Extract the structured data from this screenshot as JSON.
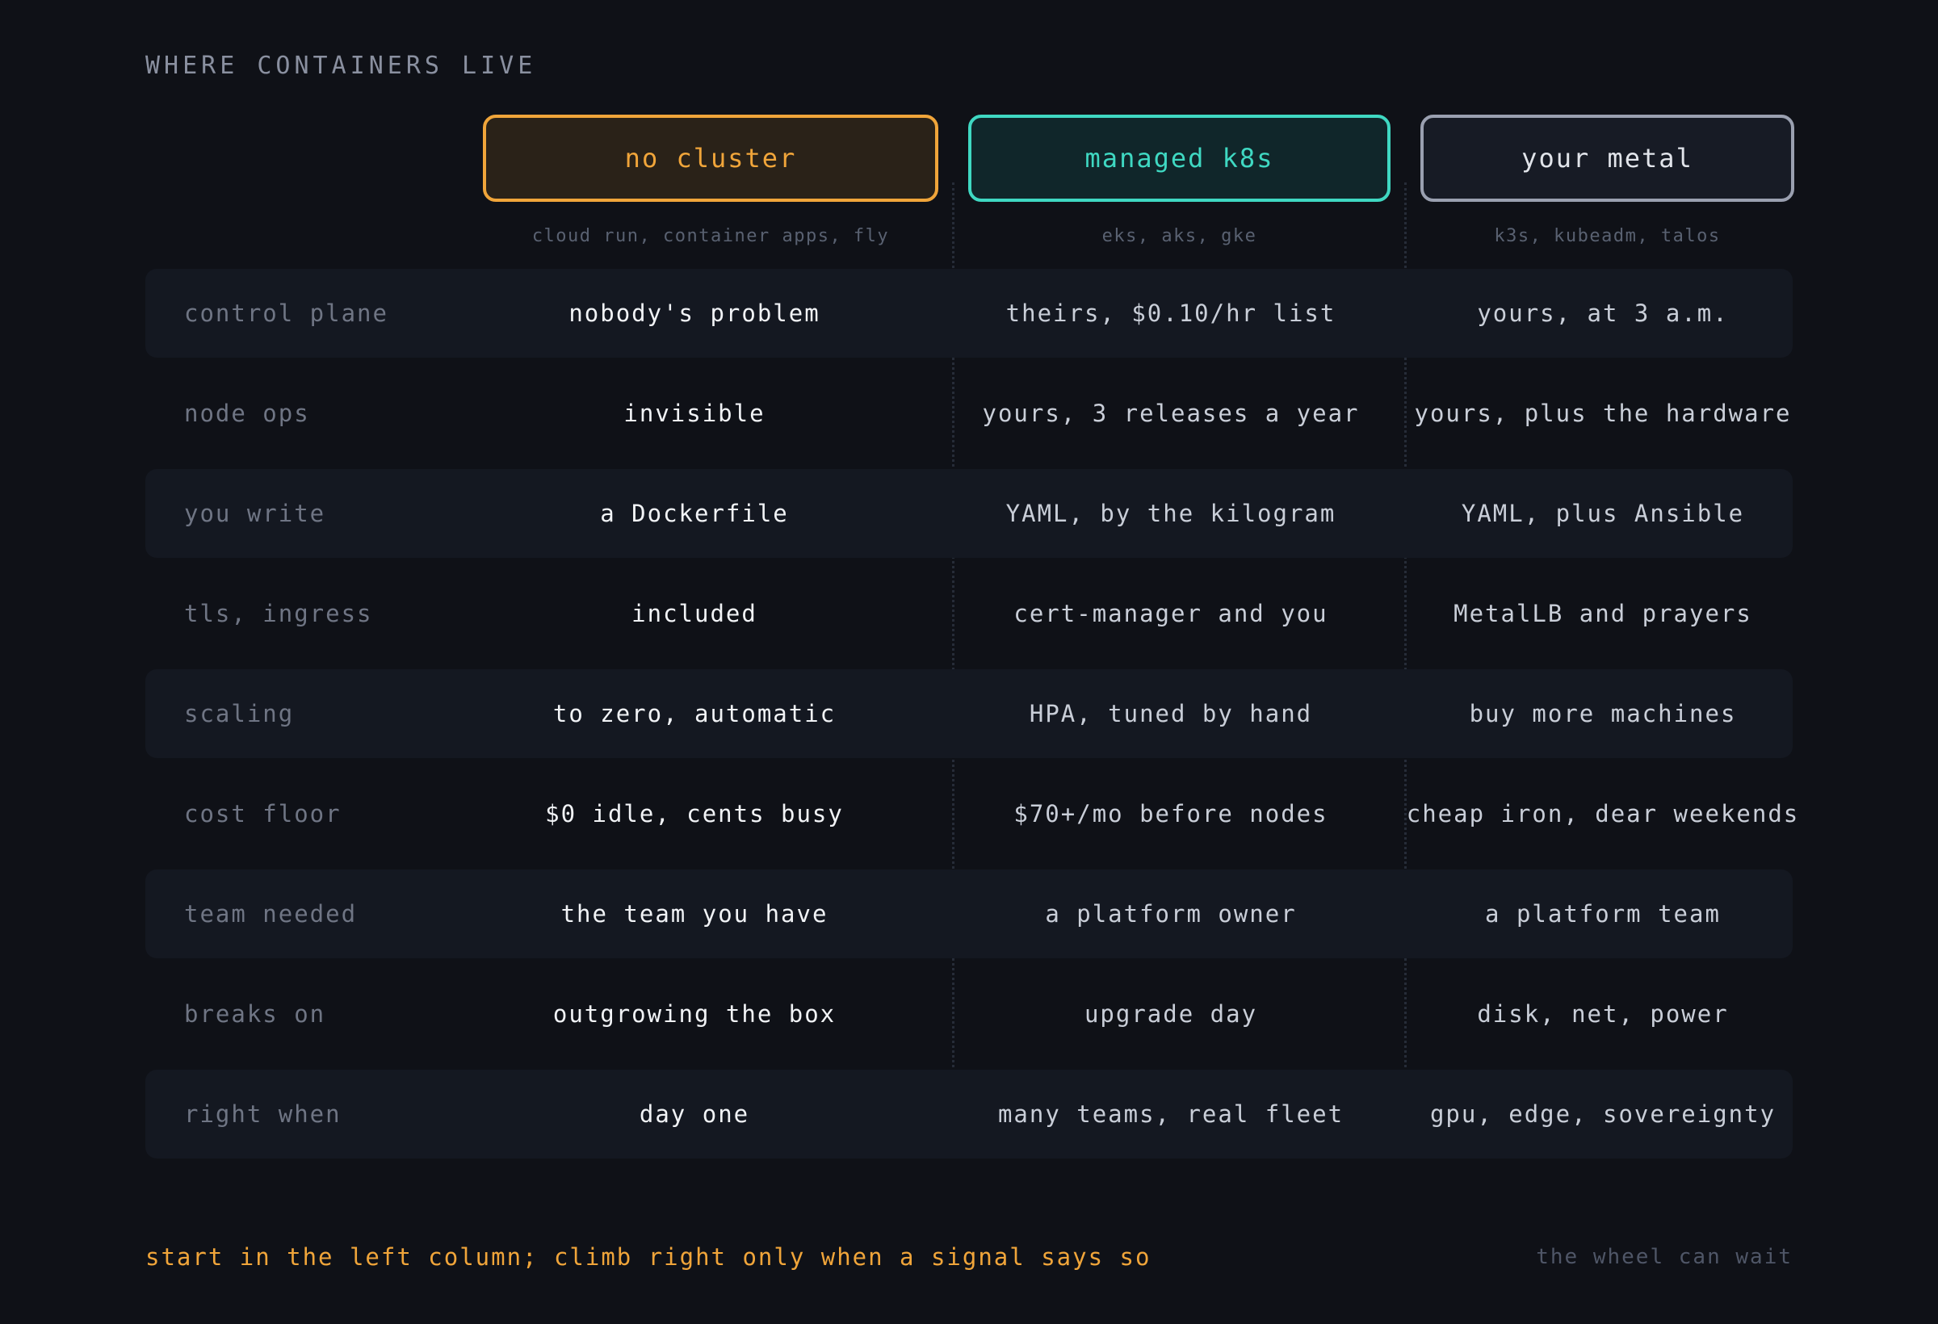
{
  "title": "WHERE CONTAINERS LIVE",
  "colors": {
    "background": "#0f1117",
    "no_cluster_accent": "#f0a53a",
    "managed_accent": "#3fd8c2",
    "metal_accent": "#9aa0b0",
    "row_band": "#141821"
  },
  "columns": [
    {
      "title": "no cluster",
      "subtitle": "cloud run, container apps, fly"
    },
    {
      "title": "managed k8s",
      "subtitle": "eks, aks, gke"
    },
    {
      "title": "your metal",
      "subtitle": "k3s, kubeadm, talos"
    }
  ],
  "rows": [
    {
      "label": "control plane",
      "values": [
        "nobody's problem",
        "theirs, $0.10/hr list",
        "yours, at 3 a.m."
      ]
    },
    {
      "label": "node ops",
      "values": [
        "invisible",
        "yours, 3 releases a year",
        "yours, plus the hardware"
      ]
    },
    {
      "label": "you write",
      "values": [
        "a Dockerfile",
        "YAML, by the kilogram",
        "YAML, plus Ansible"
      ]
    },
    {
      "label": "tls, ingress",
      "values": [
        "included",
        "cert-manager and you",
        "MetalLB and prayers"
      ]
    },
    {
      "label": "scaling",
      "values": [
        "to zero, automatic",
        "HPA, tuned by hand",
        "buy more machines"
      ]
    },
    {
      "label": "cost floor",
      "values": [
        "$0 idle, cents busy",
        "$70+/mo before nodes",
        "cheap iron, dear weekends"
      ]
    },
    {
      "label": "team needed",
      "values": [
        "the team you have",
        "a platform owner",
        "a platform team"
      ]
    },
    {
      "label": "breaks on",
      "values": [
        "outgrowing the box",
        "upgrade day",
        "disk, net, power"
      ]
    },
    {
      "label": "right when",
      "values": [
        "day one",
        "many teams, real fleet",
        "gpu, edge, sovereignty"
      ]
    }
  ],
  "footer": {
    "note": "start in the left column; climb right only when a signal says so",
    "tag": "the wheel can wait"
  }
}
